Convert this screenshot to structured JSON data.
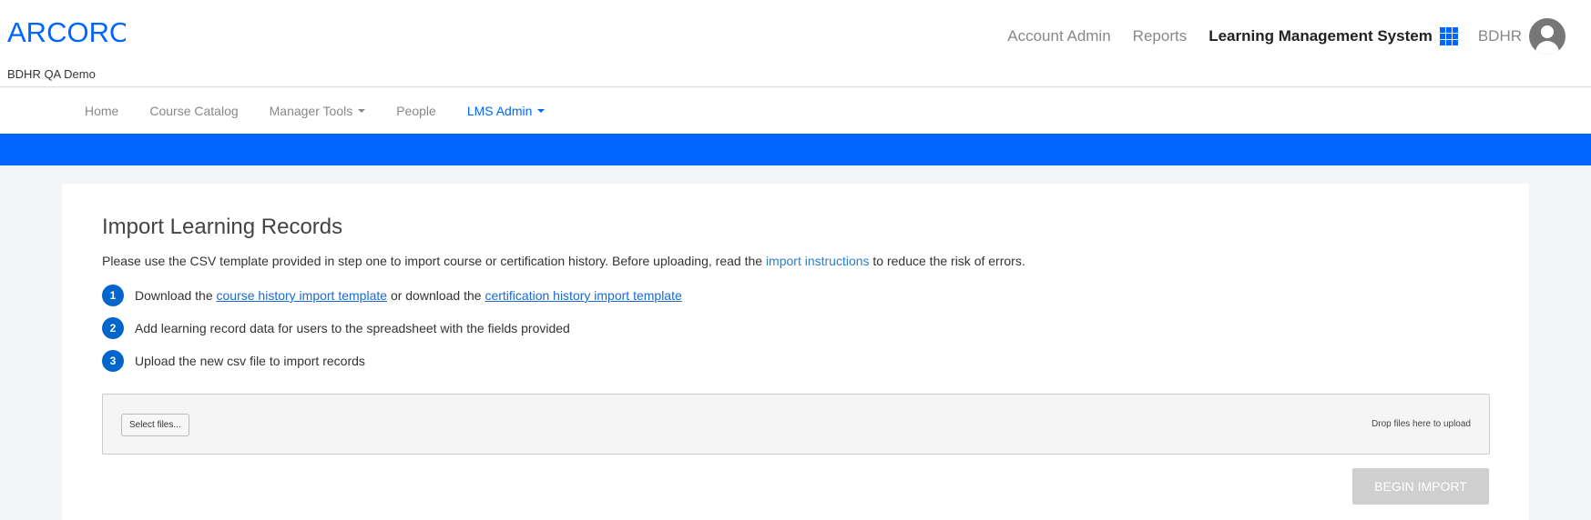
{
  "brand": {
    "logo_text": "ARCORO",
    "org_name": "BDHR QA Demo",
    "accent_color": "#0066ff"
  },
  "top_nav": {
    "links": [
      {
        "label": "Account Admin"
      },
      {
        "label": "Reports"
      },
      {
        "label": "Learning Management System"
      }
    ],
    "apps_icon": "grid-icon",
    "user_name": "BDHR",
    "avatar_icon": "user-avatar-icon"
  },
  "main_nav": {
    "items": [
      {
        "label": "Home"
      },
      {
        "label": "Course Catalog"
      },
      {
        "label": "Manager Tools"
      },
      {
        "label": "People"
      },
      {
        "label": "LMS Admin"
      }
    ]
  },
  "page": {
    "title": "Import Learning Records",
    "intro_before": "Please use the CSV template provided in step one to import course or certification history. Before uploading, read the ",
    "intro_link": "import instructions",
    "intro_after": " to reduce the risk of errors.",
    "steps": [
      {
        "num": "1",
        "text_before": "Download the ",
        "link1": "course history import template",
        "text_mid": " or download the ",
        "link2": "certification history import template"
      },
      {
        "num": "2",
        "text": "Add learning record data for users to the spreadsheet with the fields provided"
      },
      {
        "num": "3",
        "text": "Upload the new csv file to import records"
      }
    ],
    "upload": {
      "select_label": "Select files...",
      "drop_hint": "Drop files here to upload"
    },
    "begin_import_label": "BEGIN IMPORT"
  }
}
